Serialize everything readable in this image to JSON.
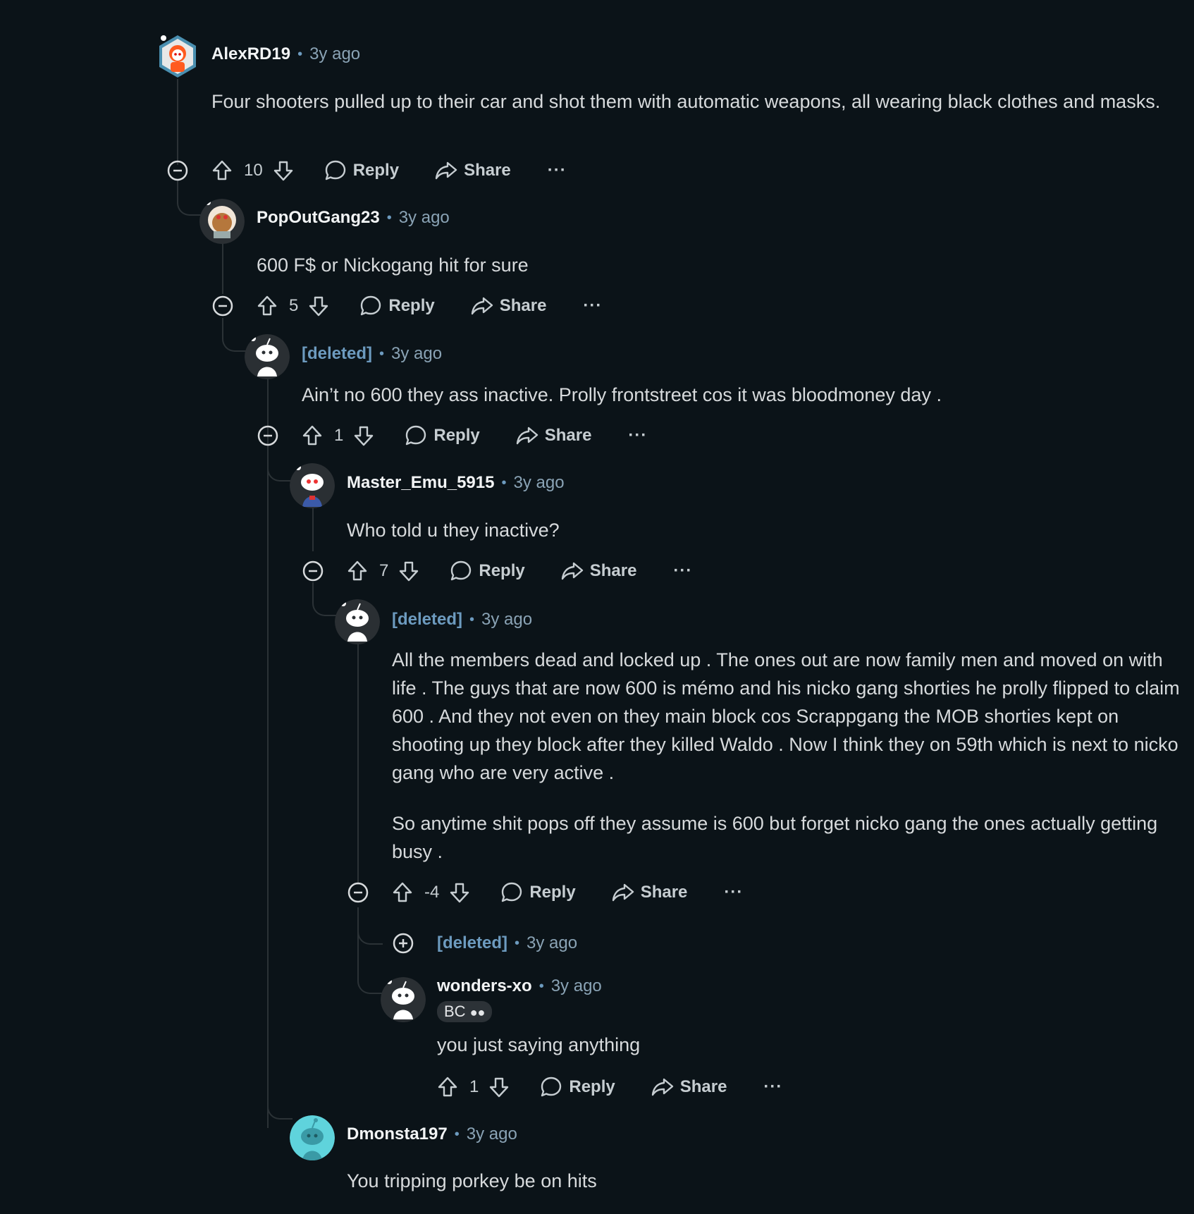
{
  "comments": [
    {
      "user": "AlexRD19",
      "time": "3y ago",
      "lines": [
        "Four shooters pulled up to their car and shot them with automatic weapons, all wearing black clothes and masks."
      ],
      "score": "10"
    },
    {
      "user": "PopOutGang23",
      "time": "3y ago",
      "lines": [
        "600 F$ or Nickogang hit for sure"
      ],
      "score": "5"
    },
    {
      "user": "[deleted]",
      "time": "3y ago",
      "lines": [
        "Ain’t no 600 they ass inactive. Prolly frontstreet cos it was bloodmoney day ."
      ],
      "score": "1"
    },
    {
      "user": "Master_Emu_5915",
      "time": "3y ago",
      "lines": [
        "Who told u they inactive?"
      ],
      "score": "7"
    },
    {
      "user": "[deleted]",
      "time": "3y ago",
      "lines": [
        "All the members dead and locked up . The ones out are now family men and moved on with life . The guys that are now 600 is mémo and his nicko gang shorties he prolly flipped to claim 600 . And they not even on they main block cos Scrappgang the MOB shorties kept on shooting up they block after they killed Waldo . Now I think they on 59th which is next to nicko gang who are very active .",
        "So anytime shit pops off they assume is 600 but forget nicko gang the ones actually getting busy ."
      ],
      "score": "-4"
    },
    {
      "user": "[deleted]",
      "time": "3y ago",
      "collapsed": true
    },
    {
      "user": "wonders-xo",
      "time": "3y ago",
      "flair": "BC",
      "lines": [
        "you just saying anything"
      ],
      "score": "1"
    },
    {
      "user": "Dmonsta197",
      "time": "3y ago",
      "lines": [
        "You tripping porkey be on hits"
      ]
    }
  ],
  "labels": {
    "reply": "Reply",
    "share": "Share",
    "more": "···",
    "separator": "•"
  },
  "colors": {
    "background": "#0b1318",
    "thread_line": "#2b3236",
    "deleted_user": "#6d9bbf",
    "timestamp": "#8aa3b5"
  },
  "icons": [
    "upvote-icon",
    "downvote-icon",
    "reply-bubble-icon",
    "share-arrow-icon",
    "collapse-minus-icon",
    "expand-plus-icon",
    "snoo-avatar"
  ]
}
